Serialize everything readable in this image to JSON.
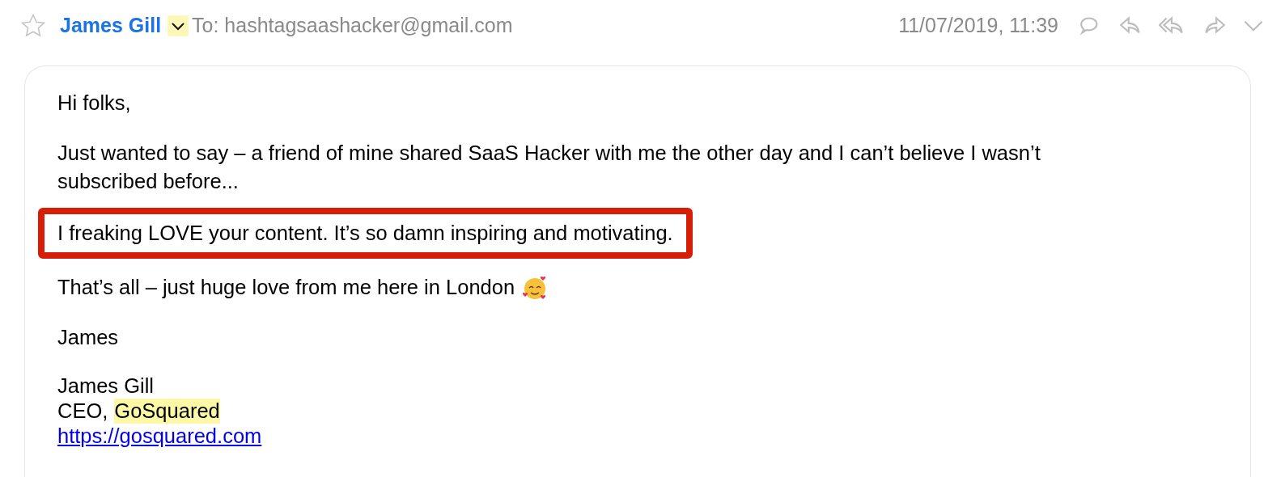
{
  "header": {
    "starred": false,
    "sender": "James Gill",
    "sender_menu_highlighted": true,
    "recipient": "To: hashtagsaashacker@gmail.com",
    "date": "11/07/2019, 11:39"
  },
  "body": {
    "paragraphs": [
      {
        "text": "Hi folks,",
        "boxed": false
      },
      {
        "text": "Just wanted to say – a friend of mine shared SaaS Hacker with me the other day and I can’t believe I wasn’t subscribed before...",
        "boxed": false
      },
      {
        "text": "I freaking LOVE your content. It’s so damn inspiring and motivating.",
        "boxed": true
      },
      {
        "text": "That’s all – just huge love from me here in London",
        "boxed": false,
        "emoji": true
      },
      {
        "text": "James",
        "boxed": false
      }
    ],
    "signature": {
      "name": "James Gill",
      "title": "CEO,",
      "company": "GoSquared",
      "company_highlighted": true,
      "link": "https://gosquared.com"
    }
  }
}
